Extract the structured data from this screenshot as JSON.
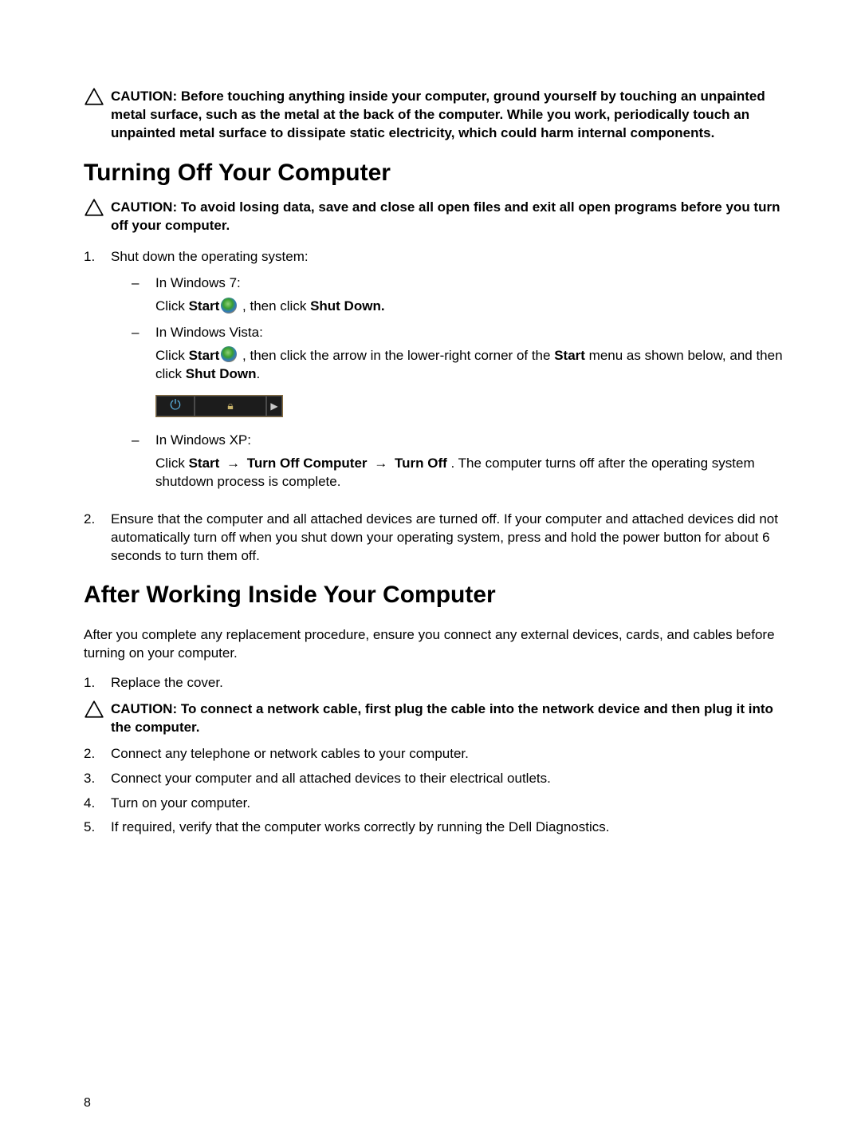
{
  "page_number": "8",
  "caution_top": {
    "label": "CAUTION:",
    "text": "Before touching anything inside your computer, ground yourself by touching an unpainted metal surface, such as the metal at the back of the computer. While you work, periodically touch an unpainted metal surface to dissipate static electricity, which could harm internal components."
  },
  "section1": {
    "title": "Turning Off Your Computer",
    "caution": {
      "label": "CAUTION:",
      "text": "To avoid losing data, save and close all open files and exit all open programs before you turn off your computer."
    },
    "step1": {
      "num": "1.",
      "text": "Shut down the operating system:",
      "win7": {
        "heading": "In Windows 7:",
        "click": "Click ",
        "start": "Start",
        "after_orb": " , then click ",
        "shutdown": "Shut Down."
      },
      "vista": {
        "heading": "In Windows Vista:",
        "click": "Click ",
        "start": "Start",
        "after_orb": " , then click the arrow in the lower-right corner of the ",
        "start2": "Start",
        "after_start2": " menu as shown below, and then click ",
        "shutdown": "Shut Down",
        "period": "."
      },
      "xp": {
        "heading": "In Windows XP:",
        "click": "Click ",
        "start": "Start",
        "arrow1": " → ",
        "turnoffcomp": "Turn Off Computer",
        "arrow2": " → ",
        "turnoff": "Turn Off ",
        "rest": ". The computer turns off after the operating system shutdown process is complete."
      }
    },
    "step2": {
      "num": "2.",
      "text": "Ensure that the computer and all attached devices are turned off. If your computer and attached devices did not automatically turn off when you shut down your operating system, press and hold the power button for about 6 seconds to turn them off."
    }
  },
  "section2": {
    "title": "After Working Inside Your Computer",
    "intro": "After you complete any replacement procedure, ensure you connect any external devices, cards, and cables before turning on your computer.",
    "step1": {
      "num": "1.",
      "text": "Replace the cover."
    },
    "caution": {
      "label": "CAUTION:",
      "text": "To connect a network cable, first plug the cable into the network device and then plug it into the computer."
    },
    "step2": {
      "num": "2.",
      "text": "Connect any telephone or network cables to your computer."
    },
    "step3": {
      "num": "3.",
      "text": "Connect your computer and all attached devices to their electrical outlets."
    },
    "step4": {
      "num": "4.",
      "text": "Turn on your computer."
    },
    "step5": {
      "num": "5.",
      "text": "If required, verify that the computer works correctly by running the Dell Diagnostics."
    }
  }
}
